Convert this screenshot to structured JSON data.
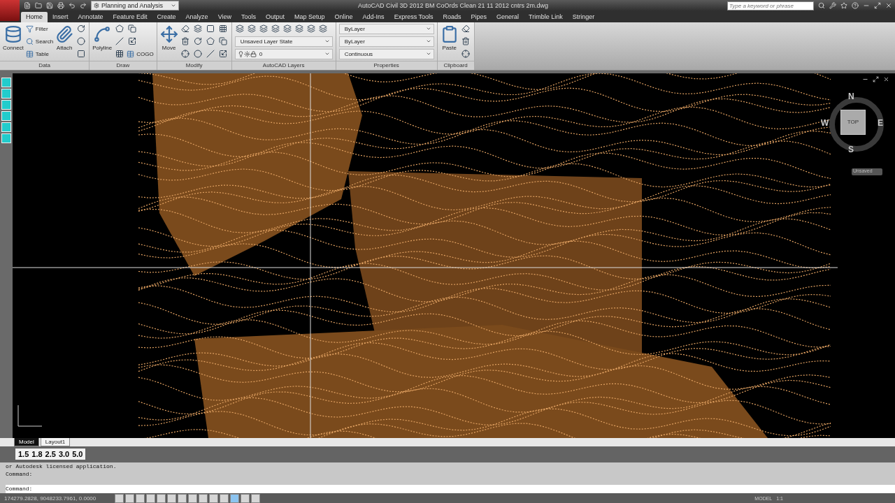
{
  "title_bar": {
    "workspace": "Planning and Analysis",
    "title": "AutoCAD Civil 3D 2012   BM CoOrds Clean 21 11 2012 cntrs  2m.dwg",
    "search": {
      "placeholder": "Type a keyword or phrase"
    }
  },
  "ribbon_tabs": [
    {
      "label": "Home",
      "selected": true
    },
    {
      "label": "Insert",
      "selected": false
    },
    {
      "label": "Annotate",
      "selected": false
    },
    {
      "label": "Feature Edit",
      "selected": false
    },
    {
      "label": "Create",
      "selected": false
    },
    {
      "label": "Analyze",
      "selected": false
    },
    {
      "label": "View",
      "selected": false
    },
    {
      "label": "Tools",
      "selected": false
    },
    {
      "label": "Output",
      "selected": false
    },
    {
      "label": "Map Setup",
      "selected": false
    },
    {
      "label": "Online",
      "selected": false
    },
    {
      "label": "Add-Ins",
      "selected": false
    },
    {
      "label": "Express Tools",
      "selected": false
    },
    {
      "label": "Roads",
      "selected": false
    },
    {
      "label": "Pipes",
      "selected": false
    },
    {
      "label": "General",
      "selected": false
    },
    {
      "label": "Trimble Link",
      "selected": false
    },
    {
      "label": "Stringer",
      "selected": false
    }
  ],
  "ribbon_panels": [
    {
      "title": "Data",
      "columns": [
        [
          {
            "kind": "large",
            "label": "Connect"
          }
        ],
        [
          {
            "kind": "small",
            "label": "Filter"
          },
          {
            "kind": "small",
            "label": "Search"
          },
          {
            "kind": "small",
            "label": "Table"
          }
        ],
        [
          {
            "kind": "large",
            "label": "Attach"
          }
        ],
        [
          {
            "kind": "icon"
          },
          {
            "kind": "icon"
          },
          {
            "kind": "icon"
          }
        ]
      ]
    },
    {
      "title": "Draw",
      "columns": [
        [
          {
            "kind": "large",
            "label": "Polyline"
          }
        ],
        [
          {
            "kind": "icon"
          },
          {
            "kind": "icon"
          },
          {
            "kind": "icon"
          }
        ],
        [
          {
            "kind": "icon"
          },
          {
            "kind": "icon"
          },
          {
            "kind": "small",
            "label": "COGO"
          }
        ]
      ]
    },
    {
      "title": "Modify",
      "columns": [
        [
          {
            "kind": "large",
            "label": "Move"
          }
        ],
        [
          {
            "kind": "icon"
          },
          {
            "kind": "icon"
          },
          {
            "kind": "icon"
          }
        ],
        [
          {
            "kind": "icon"
          },
          {
            "kind": "icon"
          },
          {
            "kind": "icon"
          }
        ],
        [
          {
            "kind": "icon"
          },
          {
            "kind": "icon"
          },
          {
            "kind": "icon"
          }
        ],
        [
          {
            "kind": "icon"
          },
          {
            "kind": "icon"
          },
          {
            "kind": "icon"
          }
        ]
      ]
    },
    {
      "title": "AutoCAD Layers",
      "columns": [
        [
          {
            "kind": "iconrow"
          },
          {
            "kind": "dropdown",
            "label": "Unsaved Layer State"
          },
          {
            "kind": "dropdown",
            "label": "0"
          }
        ]
      ]
    },
    {
      "title": "Properties",
      "columns": [
        [
          {
            "kind": "dropdown",
            "label": "ByLayer"
          },
          {
            "kind": "dropdown",
            "label": "ByLayer"
          },
          {
            "kind": "dropdown",
            "label": "Continuous"
          }
        ]
      ]
    },
    {
      "title": "Clipboard",
      "columns": [
        [
          {
            "kind": "large",
            "label": "Paste"
          }
        ],
        [
          {
            "kind": "icon"
          },
          {
            "kind": "icon"
          },
          {
            "kind": "icon"
          }
        ]
      ]
    }
  ],
  "viewcube": {
    "north": "N",
    "south": "S",
    "east": "E",
    "west": "W",
    "face": "TOP",
    "ucs": "Unsaved"
  },
  "layout_tabs": [
    {
      "label": "Model",
      "selected": true
    },
    {
      "label": "Layout1",
      "selected": false
    }
  ],
  "scale_buttons": [
    "1.5",
    "1.8",
    "2.5",
    "3.0",
    "5.0"
  ],
  "command_history": [
    "or Autodesk licensed application.",
    "Command:"
  ],
  "command_prompt": "Command:",
  "status_bar": {
    "coordinates": "174279.2828, 9048233.7961, 0.0000",
    "toggles": [
      {
        "on": false
      },
      {
        "on": false
      },
      {
        "on": false
      },
      {
        "on": false
      },
      {
        "on": false
      },
      {
        "on": false
      },
      {
        "on": false
      },
      {
        "on": false
      },
      {
        "on": false
      },
      {
        "on": false
      },
      {
        "on": false
      },
      {
        "on": true
      },
      {
        "on": false
      },
      {
        "on": false
      }
    ],
    "space": "MODEL",
    "scale": "1:1"
  }
}
